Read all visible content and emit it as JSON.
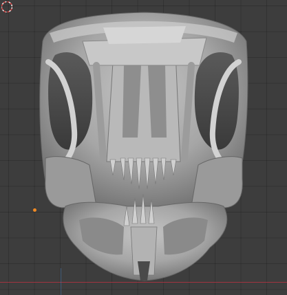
{
  "viewport": {
    "background": "#3d3d3d",
    "grid_line_color": "#2e2e2e",
    "x_axis_color": "#a33440",
    "z_axis_color": "#4f7fb5",
    "object_origin_color": "#f08a24",
    "mesh_color": "#a8a8a8",
    "scene_object": "skull-mesh",
    "cursor_icon": "3d-cursor-icon"
  }
}
